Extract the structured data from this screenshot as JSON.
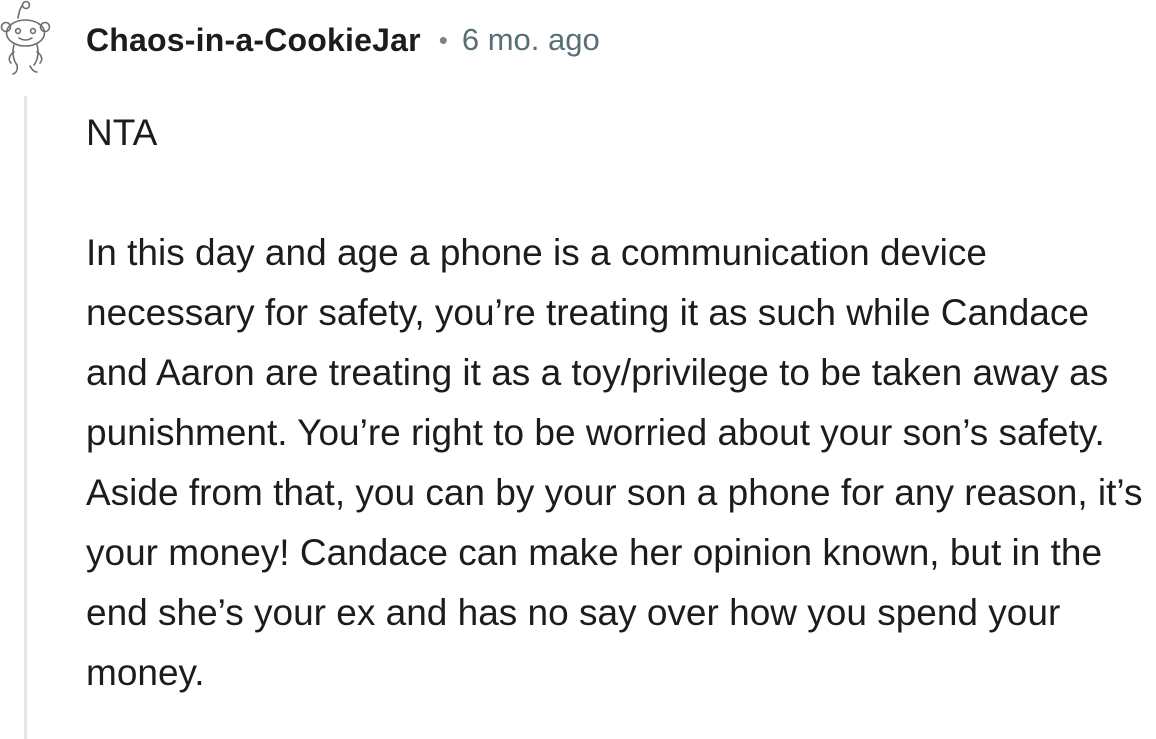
{
  "comment": {
    "author": "Chaos-in-a-CookieJar",
    "separator": "•",
    "timestamp": "6 mo. ago",
    "avatar_icon": "snoo-avatar-icon",
    "paragraphs": [
      "NTA",
      "In this day and age a phone is a communication device necessary for safety, you’re treating it as such while Candace and Aaron are treating it as a toy/privilege to be taken away as punishment. You’re right to be worried about your son’s safety. Aside from that, you can by your son a phone for any reason, it’s your money! Candace can make her opinion known, but in the end she’s your ex and has no say over how you spend your money."
    ]
  }
}
